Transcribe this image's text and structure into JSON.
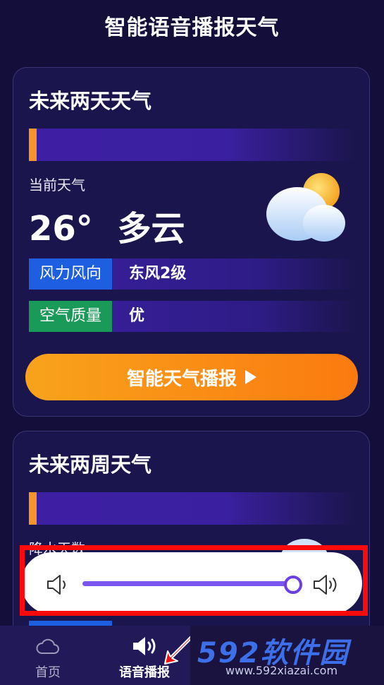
{
  "header": {
    "title": "智能语音播报天气"
  },
  "card_two_days": {
    "title": "未来两天天气",
    "current_label": "当前天气",
    "temperature": "26°",
    "condition": "多云",
    "condition_icon": "partly-cloudy-icon",
    "wind_label": "风力风向",
    "wind_value": "东风2级",
    "air_label": "空气质量",
    "air_value": "优",
    "broadcast_button": "智能天气播报"
  },
  "card_two_weeks": {
    "title": "未来两周天气",
    "precip_label": "降水天数"
  },
  "volume": {
    "level": 1.0,
    "low_icon": "speaker-low-icon",
    "high_icon": "speaker-high-icon"
  },
  "nav": {
    "items": [
      {
        "label": "首页",
        "icon": "cloud-icon"
      },
      {
        "label": "语音播报",
        "icon": "speaker-icon"
      }
    ]
  },
  "watermark": {
    "brand": "592软件园",
    "url": "www.592xiazai.com"
  },
  "colors": {
    "accent_orange": "#f7952c",
    "bg": "#130f3a",
    "slider": "#7a55ee",
    "highlight": "#ff0a0a"
  }
}
